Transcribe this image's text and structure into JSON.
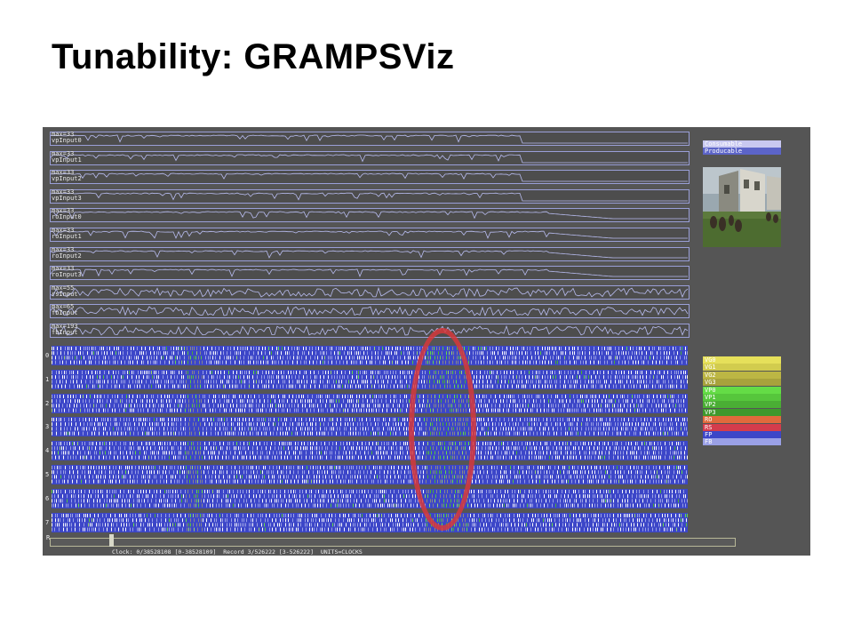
{
  "slide": {
    "title": "Tunability:  GRAMPSViz"
  },
  "traces": [
    {
      "max": "max=33",
      "name": "vpInput0"
    },
    {
      "max": "max=33",
      "name": "vpInput1"
    },
    {
      "max": "max=33",
      "name": "vpInput2"
    },
    {
      "max": "max=33",
      "name": "vpInput3"
    },
    {
      "max": "max=33",
      "name": "roInput0"
    },
    {
      "max": "max=33",
      "name": "roInput1"
    },
    {
      "max": "max=33",
      "name": "roInput2"
    },
    {
      "max": "max=33",
      "name": "roInput3"
    },
    {
      "max": "max=55",
      "name": "rsInput"
    },
    {
      "max": "max=65",
      "name": "fbInput"
    },
    {
      "max": "max=193",
      "name": "fbInput"
    }
  ],
  "cores": [
    "0",
    "1",
    "2",
    "3",
    "4",
    "5",
    "6",
    "7"
  ],
  "r_label": "R",
  "top_legend": [
    {
      "label": "Consumable",
      "color": "#c8c8f0",
      "text_color": "#ffffff"
    },
    {
      "label": "Producable",
      "color": "#5c64c8",
      "text_color": "#ffffff"
    }
  ],
  "stage_legend": [
    {
      "label": "VG0",
      "color": "#e6e05a"
    },
    {
      "label": "VG1",
      "color": "#d2cc4e"
    },
    {
      "label": "VG2",
      "color": "#bcb644"
    },
    {
      "label": "VG3",
      "color": "#a8a23c"
    },
    {
      "label": "VP0",
      "color": "#64dc46"
    },
    {
      "label": "VP1",
      "color": "#56c63c"
    },
    {
      "label": "VP2",
      "color": "#4aae34"
    },
    {
      "label": "VP3",
      "color": "#3e982c"
    },
    {
      "label": "RO",
      "color": "#e06a3c"
    },
    {
      "label": "RS",
      "color": "#d43c4c"
    },
    {
      "label": "FP",
      "color": "#3c46c8"
    },
    {
      "label": "FB",
      "color": "#9aa0e6"
    }
  ],
  "status_bar": {
    "clock": "Clock: 0/38528108 [0-38528109]",
    "record": "Record 3/526222 [3-526222]",
    "units": "UNITS=CLOCKS"
  }
}
